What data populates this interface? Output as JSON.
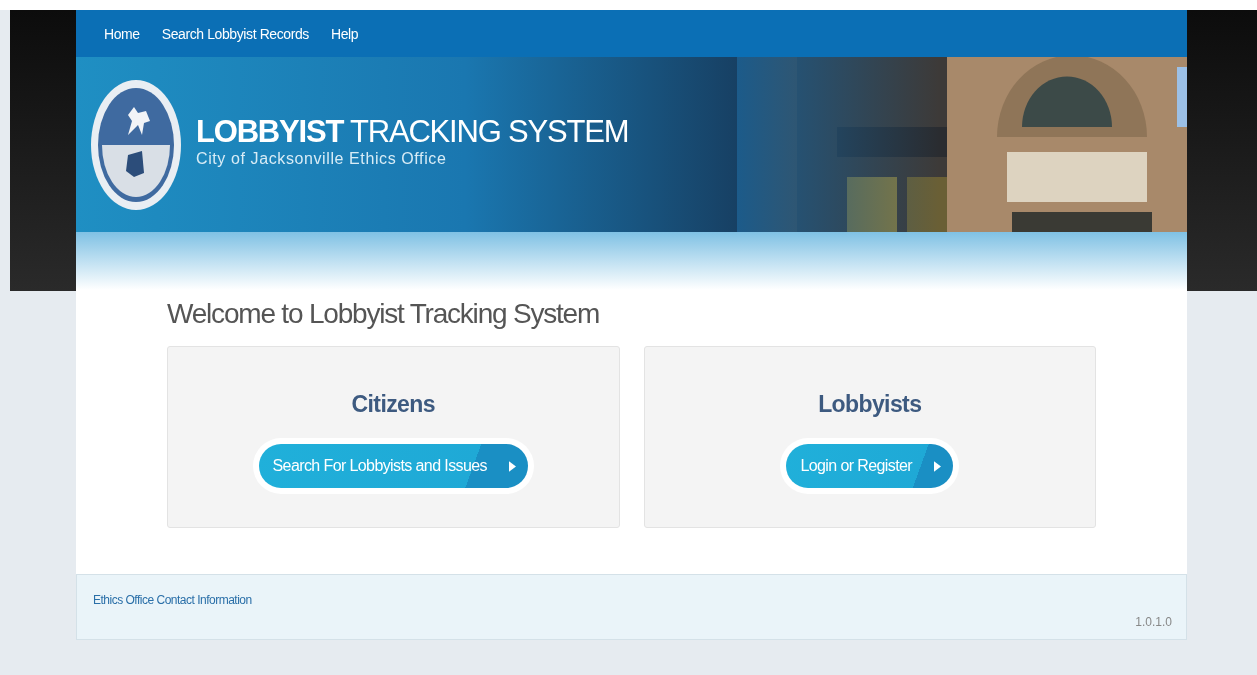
{
  "nav": [
    {
      "label": "Home"
    },
    {
      "label": "Search Lobbyist Records"
    },
    {
      "label": "Help"
    }
  ],
  "header": {
    "title": "**LOBBYIST** TRACKING SYSTEM",
    "subtitle": "City of Jacksonville Ethics Office"
  },
  "welcome": "Welcome to Lobbyist Tracking System",
  "panels": [
    {
      "title": "Citizens",
      "button": "Search For Lobbyists and Issues"
    },
    {
      "title": "Lobbyists",
      "button": "Login or Register"
    }
  ],
  "footer": {
    "link": "Ethics Office Contact Information",
    "version": "1.0.1.0"
  }
}
